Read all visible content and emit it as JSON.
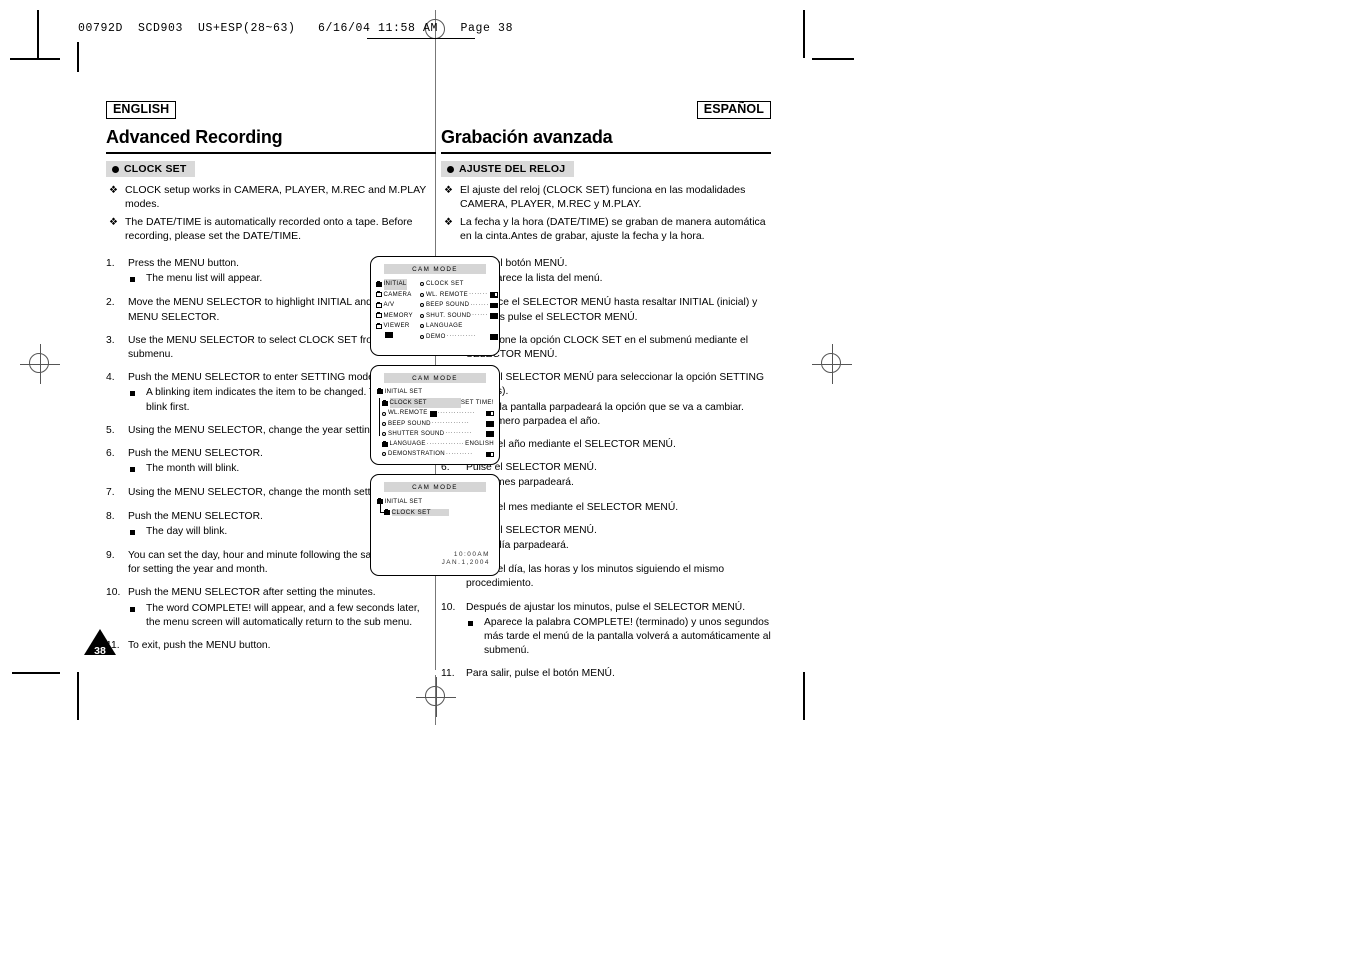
{
  "prepress": {
    "header": "00792D  SCD903  US+ESP(28~63)   6/16/04 11:58 AM   Page 38"
  },
  "english": {
    "lang_tag": "ENGLISH",
    "title": "Advanced Recording",
    "subhead": "CLOCK SET",
    "bullets": [
      "CLOCK setup works in CAMERA, PLAYER, M.REC and M.PLAY modes.",
      "The DATE/TIME is automatically recorded onto a tape. Before recording, please set the DATE/TIME."
    ],
    "steps": [
      {
        "num": "1.",
        "text": "Press the MENU button.",
        "subs": [
          "The menu list will appear."
        ]
      },
      {
        "num": "2.",
        "text": "Move the MENU SELECTOR to highlight INITIAL and push the MENU SELECTOR.",
        "subs": []
      },
      {
        "num": "3.",
        "text": "Use the MENU SELECTOR to select CLOCK SET from the submenu.",
        "subs": []
      },
      {
        "num": "4.",
        "text": "Push the MENU SELECTOR to enter SETTING mode.",
        "subs": [
          "A blinking item indicates the item to be changed. The year will blink first."
        ]
      },
      {
        "num": "5.",
        "text": "Using the MENU SELECTOR, change the year setting.",
        "subs": []
      },
      {
        "num": "6.",
        "text": "Push the MENU SELECTOR.",
        "subs": [
          "The month will blink."
        ]
      },
      {
        "num": "7.",
        "text": "Using the MENU SELECTOR, change the month setting.",
        "subs": []
      },
      {
        "num": "8.",
        "text": "Push the MENU SELECTOR.",
        "subs": [
          "The day will blink."
        ]
      },
      {
        "num": "9.",
        "text": "You can set the day, hour and minute following the same procedure for setting the year and month.",
        "subs": []
      },
      {
        "num": "10.",
        "text": "Push the MENU SELECTOR after setting the minutes.",
        "subs": [
          "The word COMPLETE! will appear, and a few seconds later, the menu screen will automatically return to the sub menu."
        ]
      },
      {
        "num": "11.",
        "text": "To exit, push the MENU button.",
        "subs": []
      }
    ]
  },
  "spanish": {
    "lang_tag": "ESPAÑOL",
    "title": "Grabación avanzada",
    "subhead": "AJUSTE DEL RELOJ",
    "bullets": [
      "El ajuste del reloj (CLOCK SET) funciona en las modalidades CAMERA, PLAYER, M.REC y M.PLAY.",
      "La fecha y la hora (DATE/TIME) se graban de manera automática en la cinta.Antes de grabar, ajuste la fecha y la hora."
    ],
    "steps": [
      {
        "num": "1.",
        "text": "Pulse el botón MENÚ.",
        "subs": [
          "Aparece la lista del menú."
        ]
      },
      {
        "num": "2.",
        "text": "Desplace el SELECTOR MENÚ hasta resaltar INITIAL (inicial) y después pulse el SELECTOR MENÚ.",
        "subs": []
      },
      {
        "num": "3.",
        "text": "Seleccione la opción CLOCK SET en el submenú mediante el SELECTOR MENÚ.",
        "subs": []
      },
      {
        "num": "4.",
        "text": "Pulse el SELECTOR MENÚ para seleccionar la opción SETTING (ajustes).",
        "subs": [
          "En la pantalla parpadeará la opción que se va a cambiar. Primero parpadea el año."
        ]
      },
      {
        "num": "5.",
        "text": "Ajuste el año mediante el SELECTOR MENÚ.",
        "subs": []
      },
      {
        "num": "6.",
        "text": "Pulse el SELECTOR MENÚ.",
        "subs": [
          "El mes parpadeará."
        ]
      },
      {
        "num": "7.",
        "text": "Ajuste el mes mediante el SELECTOR MENÚ.",
        "subs": []
      },
      {
        "num": "8.",
        "text": "Pulse el SELECTOR MENÚ.",
        "subs": [
          "El día parpadeará."
        ]
      },
      {
        "num": "9.",
        "text": "Ajuste el día, las horas y los minutos siguiendo el mismo procedimiento.",
        "subs": []
      },
      {
        "num": "10.",
        "text": "Después de ajustar los minutos, pulse el SELECTOR MENÚ.",
        "subs": [
          "Aparece la palabra COMPLETE! (terminado) y unos segundos más tarde el menú de la pantalla volverá a automáticamente al submenú."
        ]
      },
      {
        "num": "11.",
        "text": "Para salir, pulse el botón MENÚ.",
        "subs": []
      }
    ]
  },
  "lcd_screens": {
    "screen1": {
      "mode_label": "CAM MODE",
      "left_menu": [
        {
          "label": "INITIAL",
          "selected": true
        },
        {
          "label": "CAMERA",
          "selected": false
        },
        {
          "label": "A/V",
          "selected": false
        },
        {
          "label": "MEMORY",
          "selected": false
        },
        {
          "label": "VIEWER",
          "selected": false
        }
      ],
      "right_menu": [
        {
          "label": "CLOCK SET",
          "dots": "",
          "toggle": "none"
        },
        {
          "label": "WL. REMOTE",
          "dots": "·······",
          "toggle": "off"
        },
        {
          "label": "BEEP SOUND",
          "dots": "·······",
          "toggle": "on"
        },
        {
          "label": "SHUT. SOUND",
          "dots": "······",
          "toggle": "on"
        },
        {
          "label": "LANGUAGE",
          "dots": "",
          "toggle": "none"
        },
        {
          "label": "DEMO",
          "dots": "···········",
          "toggle": "on"
        }
      ]
    },
    "screen2": {
      "mode_label": "CAM MODE",
      "title": "INITIAL SET",
      "set_time_label": "SET TIME!",
      "items": [
        {
          "label": "CLOCK SET",
          "dots": "",
          "value": "",
          "toggle": "none",
          "highlighted": true
        },
        {
          "label": "WL.REMOTE",
          "dots": "··············",
          "value": "",
          "toggle": "off",
          "highlighted": false
        },
        {
          "label": "BEEP SOUND",
          "dots": "··············",
          "value": "",
          "toggle": "on",
          "highlighted": false
        },
        {
          "label": "SHUTTER SOUND",
          "dots": "··········",
          "value": "",
          "toggle": "on",
          "highlighted": false
        },
        {
          "label": "LANGUAGE",
          "dots": "··············",
          "value": "ENGLISH",
          "toggle": "none",
          "highlighted": false
        },
        {
          "label": "DEMONSTRATION",
          "dots": "··········",
          "value": "",
          "toggle": "off",
          "highlighted": false
        }
      ]
    },
    "screen3": {
      "mode_label": "CAM MODE",
      "title": "INITIAL SET",
      "sub_item": "CLOCK SET",
      "time": "10:00AM",
      "date": "JAN.1,2004"
    }
  },
  "page_number": "38"
}
